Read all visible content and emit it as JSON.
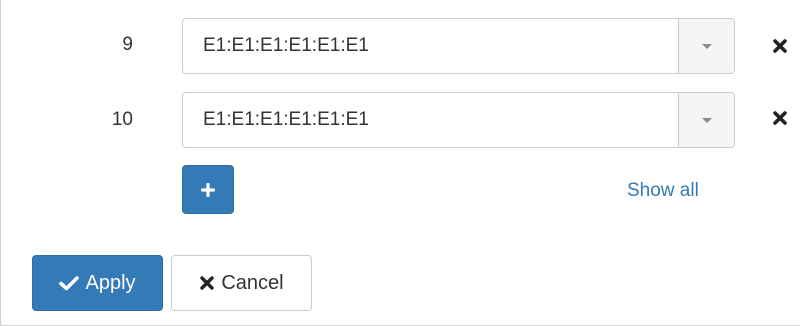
{
  "rows": [
    {
      "index": "9",
      "value": "E1:E1:E1:E1:E1:E1"
    },
    {
      "index": "10",
      "value": "E1:E1:E1:E1:E1:E1"
    }
  ],
  "actions": {
    "add_icon": "plus-icon",
    "show_all_label": "Show all",
    "apply_label": "Apply",
    "cancel_label": "Cancel"
  },
  "colors": {
    "primary": "#337ab7",
    "link": "#337ab7",
    "border": "#cccccc"
  }
}
